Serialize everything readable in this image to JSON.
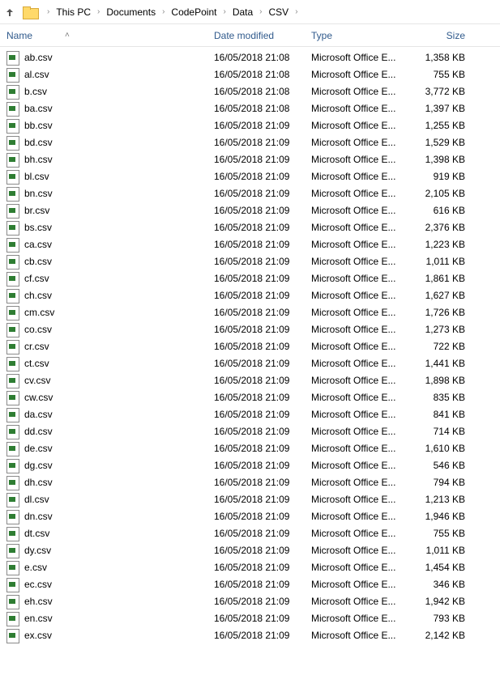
{
  "breadcrumb": [
    "This PC",
    "Documents",
    "CodePoint",
    "Data",
    "CSV"
  ],
  "columns": {
    "name": "Name",
    "date": "Date modified",
    "type": "Type",
    "size": "Size"
  },
  "files": [
    {
      "name": "ab.csv",
      "date": "16/05/2018 21:08",
      "type": "Microsoft Office E...",
      "size": "1,358 KB"
    },
    {
      "name": "al.csv",
      "date": "16/05/2018 21:08",
      "type": "Microsoft Office E...",
      "size": "755 KB"
    },
    {
      "name": "b.csv",
      "date": "16/05/2018 21:08",
      "type": "Microsoft Office E...",
      "size": "3,772 KB"
    },
    {
      "name": "ba.csv",
      "date": "16/05/2018 21:08",
      "type": "Microsoft Office E...",
      "size": "1,397 KB"
    },
    {
      "name": "bb.csv",
      "date": "16/05/2018 21:09",
      "type": "Microsoft Office E...",
      "size": "1,255 KB"
    },
    {
      "name": "bd.csv",
      "date": "16/05/2018 21:09",
      "type": "Microsoft Office E...",
      "size": "1,529 KB"
    },
    {
      "name": "bh.csv",
      "date": "16/05/2018 21:09",
      "type": "Microsoft Office E...",
      "size": "1,398 KB"
    },
    {
      "name": "bl.csv",
      "date": "16/05/2018 21:09",
      "type": "Microsoft Office E...",
      "size": "919 KB"
    },
    {
      "name": "bn.csv",
      "date": "16/05/2018 21:09",
      "type": "Microsoft Office E...",
      "size": "2,105 KB"
    },
    {
      "name": "br.csv",
      "date": "16/05/2018 21:09",
      "type": "Microsoft Office E...",
      "size": "616 KB"
    },
    {
      "name": "bs.csv",
      "date": "16/05/2018 21:09",
      "type": "Microsoft Office E...",
      "size": "2,376 KB"
    },
    {
      "name": "ca.csv",
      "date": "16/05/2018 21:09",
      "type": "Microsoft Office E...",
      "size": "1,223 KB"
    },
    {
      "name": "cb.csv",
      "date": "16/05/2018 21:09",
      "type": "Microsoft Office E...",
      "size": "1,011 KB"
    },
    {
      "name": "cf.csv",
      "date": "16/05/2018 21:09",
      "type": "Microsoft Office E...",
      "size": "1,861 KB"
    },
    {
      "name": "ch.csv",
      "date": "16/05/2018 21:09",
      "type": "Microsoft Office E...",
      "size": "1,627 KB"
    },
    {
      "name": "cm.csv",
      "date": "16/05/2018 21:09",
      "type": "Microsoft Office E...",
      "size": "1,726 KB"
    },
    {
      "name": "co.csv",
      "date": "16/05/2018 21:09",
      "type": "Microsoft Office E...",
      "size": "1,273 KB"
    },
    {
      "name": "cr.csv",
      "date": "16/05/2018 21:09",
      "type": "Microsoft Office E...",
      "size": "722 KB"
    },
    {
      "name": "ct.csv",
      "date": "16/05/2018 21:09",
      "type": "Microsoft Office E...",
      "size": "1,441 KB"
    },
    {
      "name": "cv.csv",
      "date": "16/05/2018 21:09",
      "type": "Microsoft Office E...",
      "size": "1,898 KB"
    },
    {
      "name": "cw.csv",
      "date": "16/05/2018 21:09",
      "type": "Microsoft Office E...",
      "size": "835 KB"
    },
    {
      "name": "da.csv",
      "date": "16/05/2018 21:09",
      "type": "Microsoft Office E...",
      "size": "841 KB"
    },
    {
      "name": "dd.csv",
      "date": "16/05/2018 21:09",
      "type": "Microsoft Office E...",
      "size": "714 KB"
    },
    {
      "name": "de.csv",
      "date": "16/05/2018 21:09",
      "type": "Microsoft Office E...",
      "size": "1,610 KB"
    },
    {
      "name": "dg.csv",
      "date": "16/05/2018 21:09",
      "type": "Microsoft Office E...",
      "size": "546 KB"
    },
    {
      "name": "dh.csv",
      "date": "16/05/2018 21:09",
      "type": "Microsoft Office E...",
      "size": "794 KB"
    },
    {
      "name": "dl.csv",
      "date": "16/05/2018 21:09",
      "type": "Microsoft Office E...",
      "size": "1,213 KB"
    },
    {
      "name": "dn.csv",
      "date": "16/05/2018 21:09",
      "type": "Microsoft Office E...",
      "size": "1,946 KB"
    },
    {
      "name": "dt.csv",
      "date": "16/05/2018 21:09",
      "type": "Microsoft Office E...",
      "size": "755 KB"
    },
    {
      "name": "dy.csv",
      "date": "16/05/2018 21:09",
      "type": "Microsoft Office E...",
      "size": "1,011 KB"
    },
    {
      "name": "e.csv",
      "date": "16/05/2018 21:09",
      "type": "Microsoft Office E...",
      "size": "1,454 KB"
    },
    {
      "name": "ec.csv",
      "date": "16/05/2018 21:09",
      "type": "Microsoft Office E...",
      "size": "346 KB"
    },
    {
      "name": "eh.csv",
      "date": "16/05/2018 21:09",
      "type": "Microsoft Office E...",
      "size": "1,942 KB"
    },
    {
      "name": "en.csv",
      "date": "16/05/2018 21:09",
      "type": "Microsoft Office E...",
      "size": "793 KB"
    },
    {
      "name": "ex.csv",
      "date": "16/05/2018 21:09",
      "type": "Microsoft Office E...",
      "size": "2,142 KB"
    }
  ]
}
